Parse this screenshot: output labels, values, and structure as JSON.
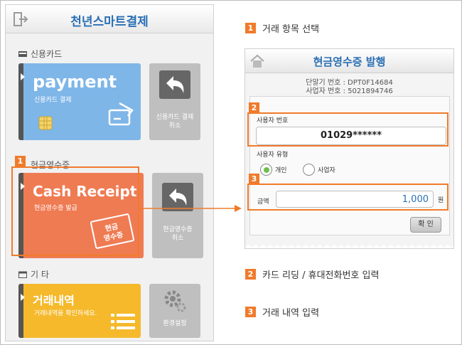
{
  "left_phone": {
    "title": "천년스마트결제",
    "section_credit": "신용카드",
    "payment_title": "payment",
    "payment_sub": "신용카드 결제",
    "credit_cancel_line1": "신용카드 결제",
    "credit_cancel_line2": "취소",
    "section_cash": "현금영수증",
    "cash_title": "Cash Receipt",
    "cash_sub": "현금영수증 발급",
    "cash_card_line1": "현금",
    "cash_card_line2": "영수증",
    "cash_cancel_line1": "현금영수증",
    "cash_cancel_line2": "취소",
    "section_etc": "기 타",
    "history_title": "거래내역",
    "history_sub": "거래내역을 확인하세요.",
    "settings_label": "환경설정",
    "badge": "1"
  },
  "steps": [
    {
      "num": "1",
      "text": "거래 항목 선택"
    },
    {
      "num": "2",
      "text": "카드 리딩 / 휴대전화번호 입력"
    },
    {
      "num": "3",
      "text": "거래 내역 입력"
    }
  ],
  "right_screen": {
    "title": "현금영수증 발행",
    "terminal": "단말기 번호 : DPT0F14684",
    "business": "사업자 번호 : 5021894746",
    "user_number_label": "사용자 번호",
    "user_number_value": "01029******",
    "user_type_label": "사용자 유형",
    "type_personal": "개인",
    "type_business": "사업자",
    "amount_label": "금액",
    "amount_value": "1,000",
    "currency": "원",
    "confirm": "확 인",
    "badge2": "2",
    "badge3": "3"
  },
  "colors": {
    "accent": "#f07b2b",
    "title_blue": "#2a6fb5",
    "payment_tile": "#7fb6e8",
    "cash_tile": "#ef7b53",
    "history_tile": "#f5b92b"
  }
}
